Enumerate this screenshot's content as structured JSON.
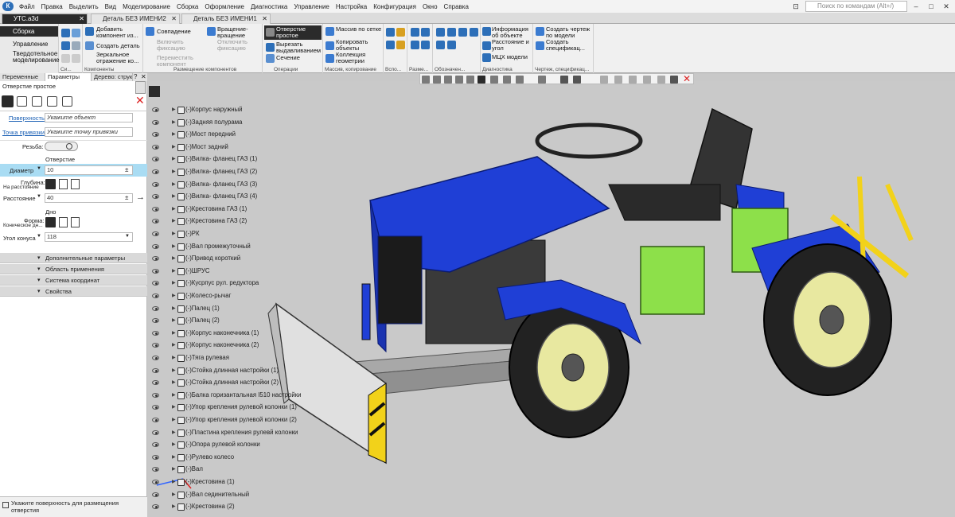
{
  "menu": {
    "logo": "К",
    "items": [
      "Файл",
      "Правка",
      "Выделить",
      "Вид",
      "Моделирование",
      "Сборка",
      "Оформление",
      "Диагностика",
      "Управление",
      "Настройка",
      "Конфигурация",
      "Окно",
      "Справка"
    ],
    "search_placeholder": "Поиск по командам (Alt+/)"
  },
  "tabs": [
    {
      "label": "УТС.a3d",
      "active": true
    },
    {
      "label": "Деталь БЕЗ ИМЕНИ2",
      "active": false
    },
    {
      "label": "Деталь БЕЗ ИМЕНИ1",
      "active": false
    }
  ],
  "ribbon": {
    "modes": [
      "Сборка",
      "Управление",
      "Твердотельное моделирование"
    ],
    "groups": {
      "system": "Си...",
      "components": "Компоненты",
      "placement": "Размещение компонентов",
      "operations": "Операции",
      "array": "Массив, копирование",
      "aux": "Вспо...",
      "size": "Разме...",
      "designations": "Обозначен...",
      "diagnostics": "Диагностика",
      "drawing": "Чертеж, спецификац..."
    },
    "components": {
      "add": "Добавить компонент из...",
      "create": "Создать деталь",
      "mirror": "Зеркальное отражение ко..."
    },
    "placement": {
      "coincidence": "Совпадение",
      "rotate": "Вращение-вращение",
      "fix_on": "Включить фиксацию",
      "move": "Переместить компонент",
      "fix_off": "Отключить фиксацию"
    },
    "operations": {
      "hole": "Отверстие простое",
      "cut": "Вырезать выдавливанием",
      "section": "Сечение"
    },
    "array": {
      "grid": "Массив по сетке",
      "copy": "Копировать объекты",
      "collection": "Коллекция геометрии"
    },
    "diagnostics": {
      "info": "Информация об объекте",
      "distance": "Расстояние и угол",
      "mcx": "МЦХ модели"
    },
    "drawing": {
      "create_drawing": "Создать чертеж по модели",
      "create_spec": "Создать спецификац..."
    }
  },
  "left_tabs": [
    "Переменные",
    "Параметры",
    "Дерево: струк..."
  ],
  "panel": {
    "title": "Отверстие простое",
    "surface_label": "Поверхность",
    "surface_value": "Укажите объект",
    "anchor_label": "Точка привязки",
    "anchor_value": "Укажите точку привязки",
    "thread_label": "Резьба:",
    "hole_header": "Отверстие",
    "diameter_label": "Диаметр",
    "diameter_value": "10",
    "depth_label": "Глубина:",
    "distance_sub": "На расстояние",
    "distance_label": "Расстояние",
    "distance_value": "40",
    "bottom_header": "Дно",
    "shape_label": "Форма:",
    "shape_sub": "Коническое дн...",
    "cone_label": "Угол конуса",
    "cone_value": "118",
    "sections": [
      "Дополнительные параметры",
      "Область применения",
      "Система координат",
      "Свойства"
    ]
  },
  "status": "Укажите поверхность для размещения отверстия",
  "tree": [
    "(-)Корпус наружный",
    "(-)Задняя полурама",
    "(-)Мост передний",
    "(-)Мост задний",
    "(-)Вилка- фланец ГАЗ (1)",
    "(-)Вилка- фланец ГАЗ (2)",
    "(-)Вилка- фланец ГАЗ (3)",
    "(-)Вилка- фланец ГАЗ (4)",
    "(-)Крестовина ГАЗ (1)",
    "(-)Крестовина ГАЗ (2)",
    "(-)РК",
    "(-)Вал промежуточный",
    "(-)Привод короткий",
    "(-)ШРУС",
    "(-)Кусрпус рул. редуктора",
    "(-)Колесо-рычаг",
    "(-)Палец (1)",
    "(-)Палец (2)",
    "(-)Корпус наконечника (1)",
    "(-)Корпус наконечника (2)",
    "(-)Тяга рулевая",
    "(-)Стойка длинная настройки (1)",
    "(-)Стойка длинная настройки (2)",
    "(-)Балка горизантальная I510 настройки",
    "(-)Упор крепления рулевой колонки (1)",
    "(-)Упор крепления рулевой колонки (2)",
    "(-)Пластина крепления рулевй колонки",
    "(-)Опора рулевой колонки",
    "(-)Рулево колесо",
    "(-)Вал",
    "(-)Крестовина (1)",
    "(-)Вал сединительный",
    "(-)Крестовина (2)"
  ],
  "colors": {
    "body": "#1f3fd6",
    "engine": "#8de04a",
    "wheel": "#e8e8a0",
    "tire": "#222222",
    "blade": "#d8d8d8",
    "yellow": "#f2d21a",
    "accent": "#2b2b2b"
  }
}
